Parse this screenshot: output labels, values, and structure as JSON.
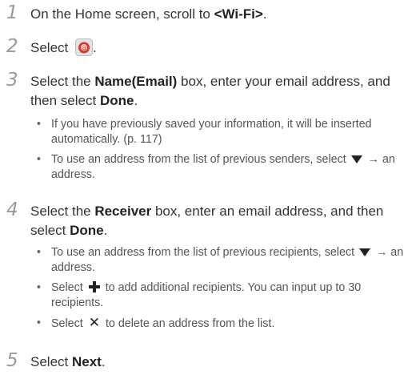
{
  "steps": [
    {
      "num": "1",
      "pre": "On the Home screen, scroll to ",
      "bold": "<Wi-Fi>",
      "post": "."
    },
    {
      "num": "2",
      "pre": "Select ",
      "post": ".",
      "icon": "email-app-icon"
    },
    {
      "num": "3",
      "pre": "Select the ",
      "bold1": "Name(Email)",
      "mid": " box, enter your email address, and then select ",
      "bold2": "Done",
      "post": ".",
      "bullets": [
        "If you have previously saved your information, it will be inserted automatically. (p. 117)",
        {
          "pre": "To use an address from the list of previous senders, select ",
          "icon": "down-triangle-icon",
          "post": " → an address."
        }
      ]
    },
    {
      "num": "4",
      "pre": "Select the ",
      "bold1": "Receiver",
      "mid": " box, enter an email address, and then select ",
      "bold2": "Done",
      "post": ".",
      "bullets": [
        {
          "pre": "To use an address from the list of previous recipients, select ",
          "icon": "down-triangle-icon",
          "post": " → an address."
        },
        {
          "pre": "Select ",
          "icon": "plus-icon",
          "post": " to add additional recipients. You can input up to 30 recipients."
        },
        {
          "pre": "Select ",
          "icon": "x-icon",
          "post": " to delete an address from the list."
        }
      ]
    },
    {
      "num": "5",
      "pre": "Select ",
      "bold": "Next",
      "post": "."
    }
  ]
}
